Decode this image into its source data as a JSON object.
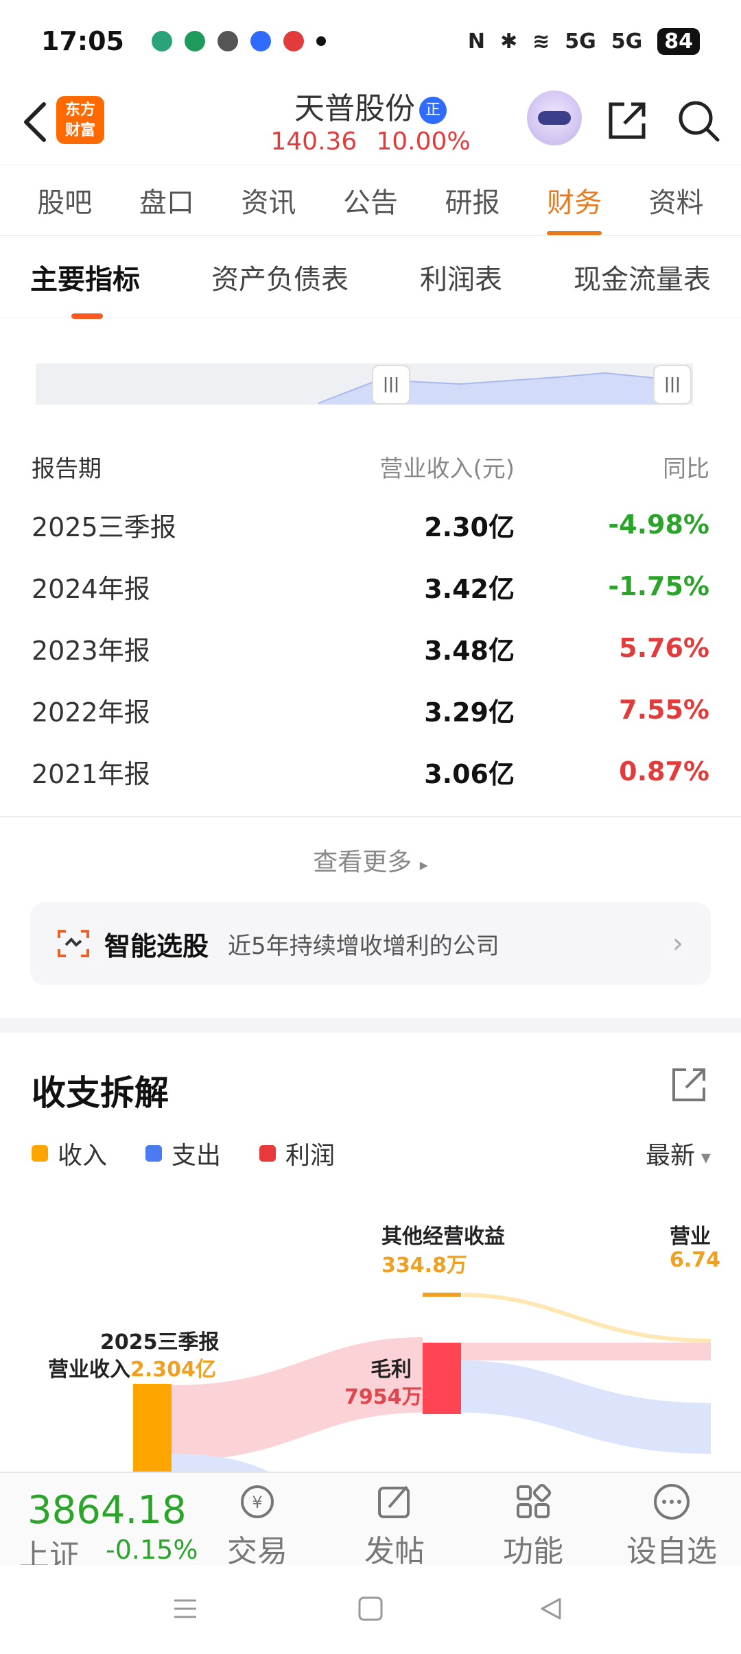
{
  "status_bar": {
    "time": "17:05",
    "battery": "84",
    "net1": "5G",
    "net2": "5G"
  },
  "header": {
    "logo_line1": "东方",
    "logo_line2": "财富",
    "stock_name": "天普股份",
    "cert_badge": "正",
    "price": "140.36",
    "change_pct": "10.00%"
  },
  "main_tabs": [
    "股吧",
    "盘口",
    "资讯",
    "公告",
    "研报",
    "财务",
    "资料"
  ],
  "sub_tabs": [
    "主要指标",
    "资产负债表",
    "利润表",
    "现金流量表"
  ],
  "table": {
    "headers": [
      "报告期",
      "营业收入(元)",
      "同比"
    ],
    "rows": [
      {
        "period": "2025三季报",
        "revenue": "2.30亿",
        "yoy": "-4.98%"
      },
      {
        "period": "2024年报",
        "revenue": "3.42亿",
        "yoy": "-1.75%"
      },
      {
        "period": "2023年报",
        "revenue": "3.48亿",
        "yoy": "5.76%"
      },
      {
        "period": "2022年报",
        "revenue": "3.29亿",
        "yoy": "7.55%"
      },
      {
        "period": "2021年报",
        "revenue": "3.06亿",
        "yoy": "0.87%"
      }
    ]
  },
  "view_more": "查看更多",
  "smart_pick": {
    "title": "智能选股",
    "desc": "近5年持续增收增利的公司"
  },
  "breakdown": {
    "title": "收支拆解",
    "legend": [
      {
        "label": "收入",
        "color": "#FFA500"
      },
      {
        "label": "支出",
        "color": "#4A7BF0"
      },
      {
        "label": "利润",
        "color": "#E83A3A"
      }
    ],
    "filter": "最新",
    "nodes": {
      "revenue_period": "2025三季报",
      "revenue_label": "营业收入",
      "revenue_value": "2.304亿",
      "other_label": "其他经营收益",
      "other_value": "334.8万",
      "gross_label": "毛利",
      "gross_value": "7954万",
      "op_label": "营业",
      "op_value": "6.74"
    }
  },
  "bottom_bar": {
    "index_value": "3864.18",
    "index_name": "上证",
    "index_change": "-0.15%",
    "nav": [
      "交易",
      "发帖",
      "功能",
      "设自选"
    ]
  }
}
